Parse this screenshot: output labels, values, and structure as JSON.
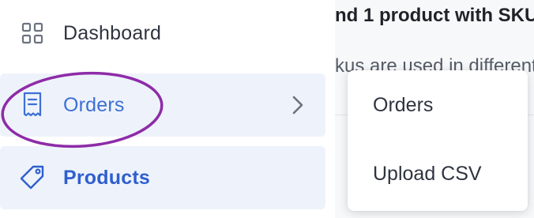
{
  "sidebar": {
    "items": [
      {
        "label": "Dashboard",
        "icon": "grid-icon"
      },
      {
        "label": "Orders",
        "icon": "receipt-icon",
        "has_submenu": true
      },
      {
        "label": "Products",
        "icon": "tag-icon"
      }
    ]
  },
  "content": {
    "heading": "nd 1 product with SKU",
    "subtext": "kus are used in different"
  },
  "dropdown": {
    "items": [
      {
        "label": "Orders"
      },
      {
        "label": "Upload CSV"
      }
    ]
  },
  "colors": {
    "accent": "#3d6fd6",
    "annotation": "#8e2ca8",
    "highlight_bg": "#eef3fb"
  }
}
